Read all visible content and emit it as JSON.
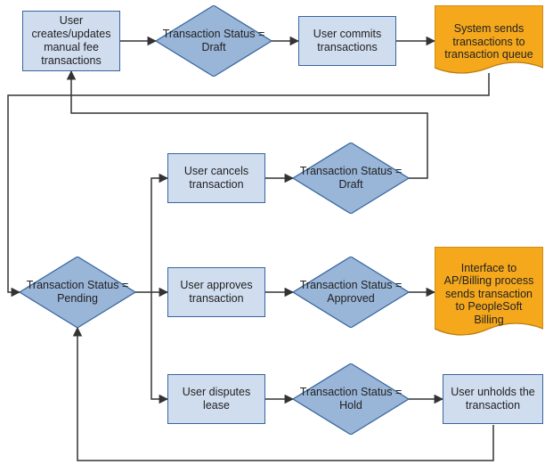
{
  "row1": {
    "create": "User creates/updates manual fee transactions",
    "status_draft": "Transaction Status = Draft",
    "commit": "User commits transactions",
    "queue": "System sends transactions to transaction queue"
  },
  "row2": {
    "pending": "Transaction Status = Pending",
    "cancel": "User cancels transaction",
    "cancel_status": "Transaction Status = Draft",
    "approve": "User approves transaction",
    "approve_status": "Transaction Status = Approved",
    "billing": "Interface to AP/Billing process sends transaction to PeopleSoft Billing",
    "dispute": "User disputes lease",
    "dispute_status": "Transaction Status = Hold",
    "unhold": "User unholds the transaction"
  },
  "colors": {
    "rect_fill": "#d0ddef",
    "rect_stroke": "#36659e",
    "diamond_fill": "#99b5d7",
    "diamond_stroke": "#36659e",
    "doc_fill": "#f5a81c",
    "doc_stroke": "#bd7e0c",
    "line": "#333333"
  }
}
